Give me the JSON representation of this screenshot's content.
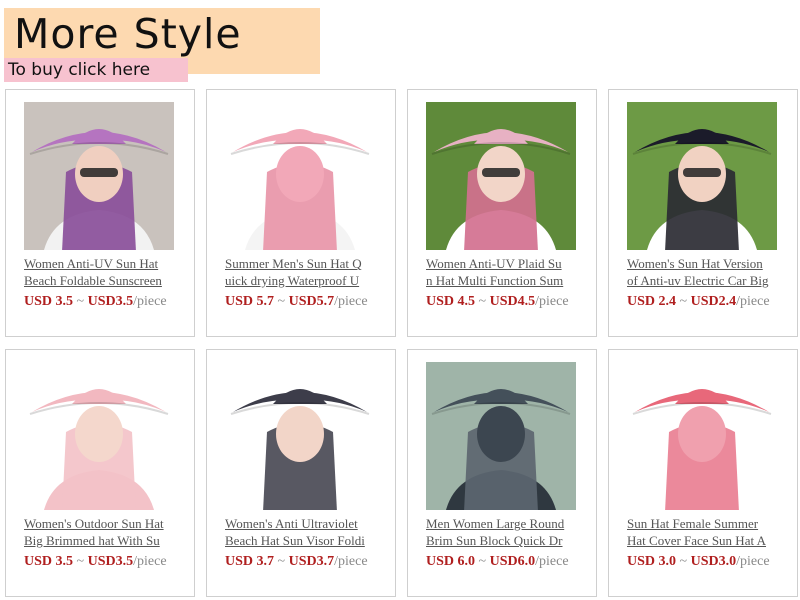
{
  "banner": {
    "title": "More Style",
    "subtitle": "To buy click here"
  },
  "products": [
    {
      "title_line1": "Women Anti-UV Sun Hat",
      "title_line2": "Beach Foldable Sunscreen",
      "price_from": "USD 3.5",
      "price_sep": " ~ ",
      "price_to": "USD3.5",
      "unit": "/piece",
      "photo": {
        "bg": "#c9c2bd",
        "hat": "#b574c0",
        "face": "#f0cfc0",
        "wrap": "#8a4f9a",
        "shirt": "#f2f2f2"
      }
    },
    {
      "title_line1": "Summer Men's Sun Hat Q",
      "title_line2": "uick drying Waterproof U",
      "price_from": "USD 5.7",
      "price_sep": " ~ ",
      "price_to": "USD5.7",
      "unit": "/piece",
      "photo": {
        "bg": "#ffffff",
        "hat": "#f2a8b8",
        "face": "#f2a8b8",
        "wrap": "#e895a8",
        "shirt": "#f4f4f4"
      }
    },
    {
      "title_line1": "Women Anti-UV Plaid Su",
      "title_line2": "n Hat Multi Function Sum",
      "price_from": "USD 4.5",
      "price_sep": " ~ ",
      "price_to": "USD4.5",
      "unit": "/piece",
      "photo": {
        "bg": "#5f8a3a",
        "hat": "#e7b1c3",
        "face": "#f2d5c8",
        "wrap": "#d2708f",
        "shirt": "#ffffff"
      }
    },
    {
      "title_line1": "Women's Sun Hat Version",
      "title_line2": "of Anti-uv Electric Car Big",
      "price_from": "USD 2.4",
      "price_sep": " ~ ",
      "price_to": "USD2.4",
      "unit": "/piece",
      "photo": {
        "bg": "#6d9a45",
        "hat": "#1b1b2a",
        "face": "#f1d2c2",
        "wrap": "#2b2b33",
        "shirt": "#ffffff"
      }
    },
    {
      "title_line1": "Women's Outdoor Sun Hat",
      "title_line2": "Big Brimmed hat With Su",
      "price_from": "USD 3.5",
      "price_sep": " ~ ",
      "price_to": "USD3.5",
      "unit": "/piece",
      "photo": {
        "bg": "#ffffff",
        "hat": "#f2b8c0",
        "face": "#f4d7cc",
        "wrap": "#f3c2c8",
        "shirt": "#f3c2c8"
      }
    },
    {
      "title_line1": "Women's Anti Ultraviolet",
      "title_line2": "Beach Hat Sun Visor Foldi",
      "price_from": "USD 3.7",
      "price_sep": " ~ ",
      "price_to": "USD3.7",
      "unit": "/piece",
      "photo": {
        "bg": "#ffffff",
        "hat": "#3d3d4a",
        "face": "#f2d5c8",
        "wrap": "#4a4a55",
        "shirt": "#ffffff"
      }
    },
    {
      "title_line1": "Men Women Large Round",
      "title_line2": "Brim Sun Block Quick Dr",
      "price_from": "USD 6.0",
      "price_sep": " ~ ",
      "price_to": "USD6.0",
      "unit": "/piece",
      "photo": {
        "bg": "#9fb4a8",
        "hat": "#44505a",
        "face": "#3c4650",
        "wrap": "#5c6670",
        "shirt": "#2f3840"
      }
    },
    {
      "title_line1": "Sun Hat Female Summer",
      "title_line2": "Hat Cover Face Sun Hat A",
      "price_from": "USD 3.0",
      "price_sep": " ~ ",
      "price_to": "USD3.0",
      "unit": "/piece",
      "photo": {
        "bg": "#ffffff",
        "hat": "#e8687a",
        "face": "#f0a0ae",
        "wrap": "#e97f92",
        "shirt": "#ffffff"
      }
    }
  ]
}
